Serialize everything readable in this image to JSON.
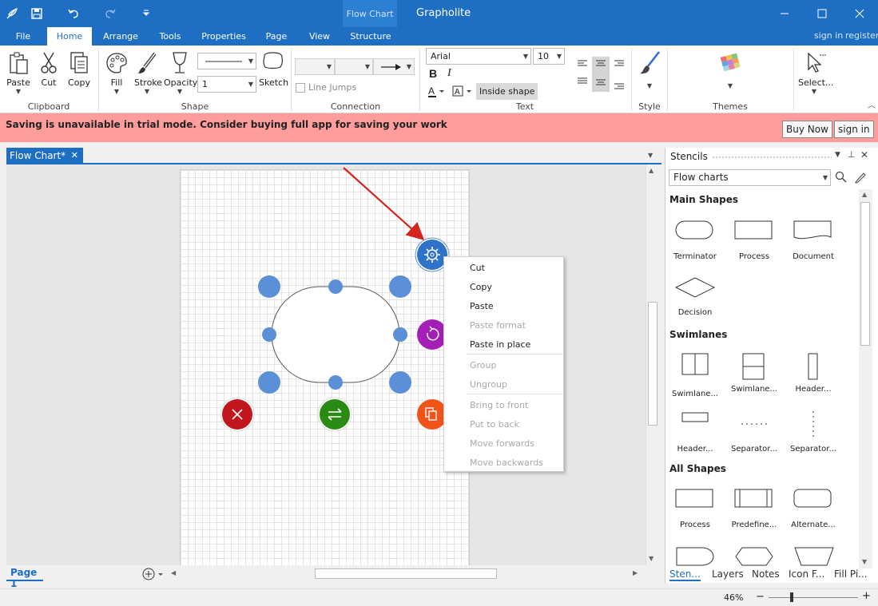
{
  "app": {
    "title": "Grapholite",
    "context_group": "Flow Chart"
  },
  "tabs": [
    "File",
    "Home",
    "Arrange",
    "Tools",
    "Properties",
    "Page",
    "View",
    "Structure"
  ],
  "account": {
    "sign_in": "sign in",
    "register": "register"
  },
  "ribbon": {
    "clipboard": {
      "paste": "Paste",
      "cut": "Cut",
      "copy": "Copy",
      "group": "Clipboard"
    },
    "shape": {
      "fill": "Fill",
      "stroke": "Stroke",
      "opacity": "Opacity",
      "sketch": "Sketch",
      "stroke_width": "1",
      "group": "Shape"
    },
    "connection": {
      "line_jumps": "Line Jumps",
      "group": "Connection"
    },
    "text": {
      "font": "Arial",
      "size": "10",
      "bold": "B",
      "italic": "I",
      "inside_shape": "Inside shape",
      "group": "Text"
    },
    "style": {
      "group": "Style"
    },
    "themes": {
      "group": "Themes"
    },
    "select": {
      "label": "Select..."
    }
  },
  "trial": {
    "message": "Saving is unavailable in trial mode. Consider buying full app for saving your work",
    "buy": "Buy Now",
    "sign_in": "sign in"
  },
  "document": {
    "tab": "Flow Chart*",
    "close": "✕",
    "page": "Page 1",
    "zoom": "46%"
  },
  "context_menu": {
    "items": [
      {
        "label": "Cut",
        "enabled": true
      },
      {
        "label": "Copy",
        "enabled": true
      },
      {
        "label": "Paste",
        "enabled": true
      },
      {
        "label": "Paste format",
        "enabled": false
      },
      {
        "label": "Paste in place",
        "enabled": true
      },
      {
        "label": "Group",
        "enabled": false
      },
      {
        "label": "Ungroup",
        "enabled": false
      },
      {
        "label": "Bring to front",
        "enabled": false
      },
      {
        "label": "Put to back",
        "enabled": false
      },
      {
        "label": "Move forwards",
        "enabled": false
      },
      {
        "label": "Move backwards",
        "enabled": false
      }
    ]
  },
  "stencils": {
    "title": "Stencils",
    "library": "Flow charts",
    "sections": [
      {
        "name": "Main Shapes",
        "shapes": [
          "Terminator",
          "Process",
          "Document",
          "Decision"
        ]
      },
      {
        "name": "Swimlanes",
        "shapes": [
          "Swimlane...",
          "Swimlane...",
          "Header...",
          "Header...",
          "Separator...",
          "Separator..."
        ]
      },
      {
        "name": "All Shapes",
        "shapes": [
          "Process",
          "Predefine...",
          "Alternate..."
        ]
      }
    ],
    "bottom_tabs": [
      "Sten...",
      "Layers",
      "Notes",
      "Icon F...",
      "Fill Pi..."
    ]
  },
  "colors": {
    "accent": "#1e6fc4",
    "trial_bg": "#ff9d9d",
    "handle": "#5b8fd6",
    "delete": "#c0161c",
    "convert": "#2b8a14",
    "rotate": "#a41fb5",
    "duplicate": "#f25318"
  }
}
